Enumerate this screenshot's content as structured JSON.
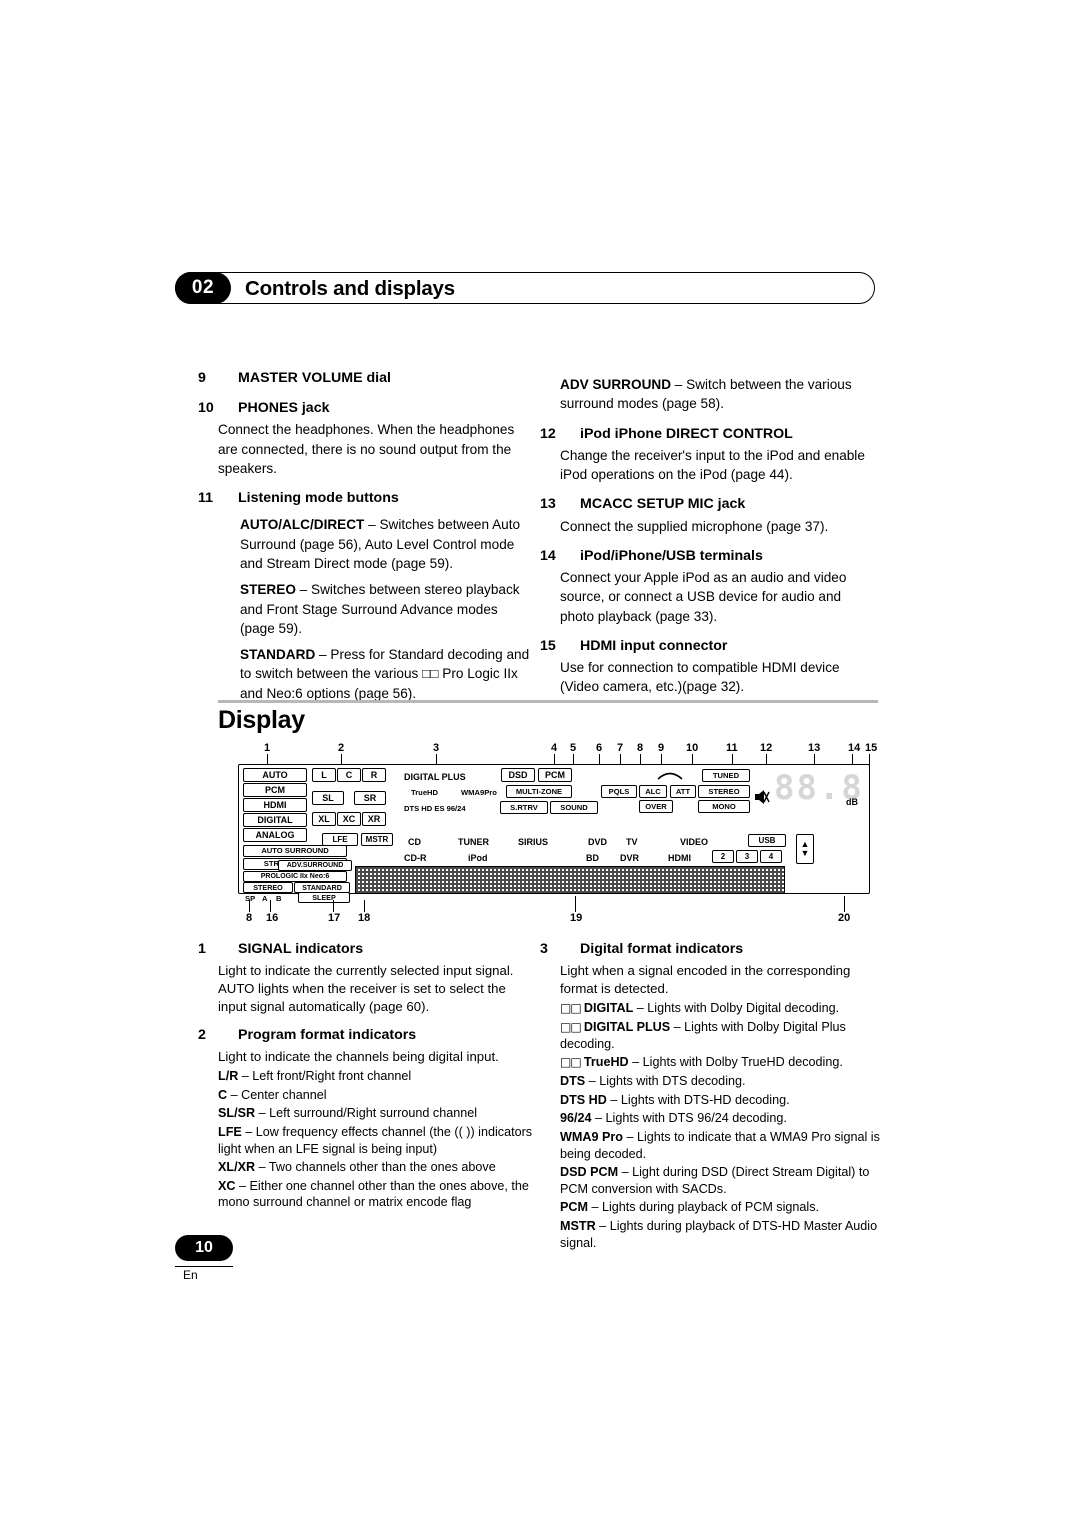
{
  "header": {
    "chapter": "02",
    "title": "Controls and displays"
  },
  "left_column": [
    {
      "type": "head",
      "num": "9",
      "text": "MASTER VOLUME dial"
    },
    {
      "type": "head",
      "num": "10",
      "text": "PHONES jack"
    },
    {
      "type": "para",
      "text": "Connect the headphones. When the headphones are connected, there is no sound output from the speakers."
    },
    {
      "type": "head",
      "num": "11",
      "text": "Listening mode buttons"
    },
    {
      "type": "para_bold_lead",
      "lead": "AUTO/ALC/DIRECT",
      "text": " – Switches between Auto Surround (page 56), Auto Level Control mode and Stream Direct mode (page 59)."
    },
    {
      "type": "para_bold_lead",
      "lead": "STEREO",
      "text": " – Switches between stereo playback and Front Stage Surround Advance modes (page 59)."
    },
    {
      "type": "para_bold_lead",
      "lead": "STANDARD",
      "text": " – Press for Standard decoding and to switch between the various □□ Pro Logic IIx and Neo:6 options (page 56)."
    }
  ],
  "right_column": [
    {
      "type": "para_bold_lead",
      "lead": "ADV SURROUND",
      "text": " – Switch between the various surround modes (page 58)."
    },
    {
      "type": "head",
      "num": "12",
      "text": "iPod iPhone DIRECT CONTROL"
    },
    {
      "type": "para",
      "text": "Change the receiver's input to the iPod and enable iPod operations on the iPod (page 44)."
    },
    {
      "type": "head",
      "num": "13",
      "text": "MCACC SETUP MIC jack"
    },
    {
      "type": "para",
      "text": "Connect the supplied microphone (page 37)."
    },
    {
      "type": "head",
      "num": "14",
      "text": "iPod/iPhone/USB terminals"
    },
    {
      "type": "para",
      "text": "Connect your Apple iPod as an audio and video source, or connect a USB device for audio and photo playback (page 33)."
    },
    {
      "type": "head",
      "num": "15",
      "text": "HDMI input connector"
    },
    {
      "type": "para",
      "text": "Use for connection to compatible HDMI device (Video camera, etc.)(page 32)."
    }
  ],
  "section": {
    "title": "Display"
  },
  "diagram": {
    "callouts_top": [
      "1",
      "2",
      "3",
      "4",
      "5",
      "6",
      "7",
      "8",
      "9",
      "10",
      "11",
      "12",
      "13",
      "14",
      "15"
    ],
    "callouts_bottom": [
      "8",
      "16",
      "17",
      "18",
      "19",
      "20"
    ],
    "signal_labels": [
      "AUTO",
      "PCM",
      "HDMI",
      "DIGITAL",
      "ANALOG"
    ],
    "channel_labels": [
      "L",
      "C",
      "R",
      "SL",
      "SR",
      "XL",
      "XC",
      "XR",
      "LFE",
      "MSTR"
    ],
    "format_labels": [
      "DIGITAL PLUS",
      "DSD",
      "PCM",
      "TrueHD",
      "WMA9Pro",
      "MULTI-ZONE",
      "DTS HD ES 96/24",
      "S.RTRV",
      "SOUND",
      "PQLS",
      "ALC",
      "ATT",
      "OVER",
      "TUNED",
      "STEREO",
      "MONO"
    ],
    "mode_labels": [
      "AUTO SURROUND",
      "STREAM DIRECT",
      "PROLOGIC IIx Neo:6",
      "ADV.SURROUND",
      "STEREO",
      "STANDARD",
      "SP",
      "A",
      "B",
      "SLEEP"
    ],
    "input_row1": [
      "CD",
      "TUNER",
      "SIRIUS",
      "DVD",
      "TV",
      "VIDEO",
      "USB"
    ],
    "input_row2": [
      "CD-R",
      "iPod",
      "BD",
      "DVR",
      "HDMI",
      "2",
      "3",
      "4"
    ],
    "segment_display": "88.8",
    "db_label": "dB"
  },
  "lower_left": [
    {
      "type": "head",
      "num": "1",
      "text": "SIGNAL indicators"
    },
    {
      "type": "para",
      "text": "Light to indicate the currently selected input signal. AUTO lights when the receiver is set to select the input signal automatically (page 60)."
    },
    {
      "type": "head",
      "num": "2",
      "text": "Program format indicators"
    },
    {
      "type": "para",
      "text": "Light to indicate the channels being digital input."
    },
    {
      "type": "defn",
      "term": "L/R",
      "text": " – Left front/Right front channel"
    },
    {
      "type": "defn",
      "term": "C",
      "text": " – Center channel"
    },
    {
      "type": "defn",
      "term": "SL/SR",
      "text": " – Left surround/Right surround channel"
    },
    {
      "type": "defn",
      "term": "LFE",
      "text": " – Low frequency effects channel (the (( )) indicators light when an LFE signal is being input)"
    },
    {
      "type": "defn",
      "term": "XL/XR",
      "text": " – Two channels other than the ones above"
    },
    {
      "type": "defn",
      "term": "XC",
      "text": " – Either one channel other than the ones above, the mono surround channel or matrix encode flag"
    }
  ],
  "lower_right": [
    {
      "type": "head",
      "num": "3",
      "text": "Digital format indicators"
    },
    {
      "type": "para",
      "text": "Light when a signal encoded in the corresponding format is detected."
    },
    {
      "type": "defn_dd",
      "term": "DIGITAL",
      "text": " – Lights with Dolby Digital decoding."
    },
    {
      "type": "defn_dd",
      "term": "DIGITAL PLUS",
      "text": " – Lights with Dolby Digital Plus decoding."
    },
    {
      "type": "defn_dd",
      "term": "TrueHD",
      "text": " – Lights with Dolby TrueHD decoding."
    },
    {
      "type": "defn",
      "term": "DTS",
      "text": " – Lights with DTS decoding."
    },
    {
      "type": "defn",
      "term": "DTS HD",
      "text": " – Lights with DTS-HD decoding."
    },
    {
      "type": "defn",
      "term": "96/24",
      "text": " – Lights with DTS 96/24 decoding."
    },
    {
      "type": "defn",
      "term": "WMA9 Pro",
      "text": " – Lights to indicate that a WMA9 Pro signal is being decoded."
    },
    {
      "type": "defn",
      "term": "DSD PCM",
      "text": " – Light during DSD (Direct Stream Digital) to PCM conversion with SACDs."
    },
    {
      "type": "defn",
      "term": "PCM",
      "text": " – Lights during playback of PCM signals."
    },
    {
      "type": "defn",
      "term": "MSTR",
      "text": " – Lights during playback of DTS-HD Master Audio signal."
    }
  ],
  "footer": {
    "page": "10",
    "lang": "En"
  }
}
